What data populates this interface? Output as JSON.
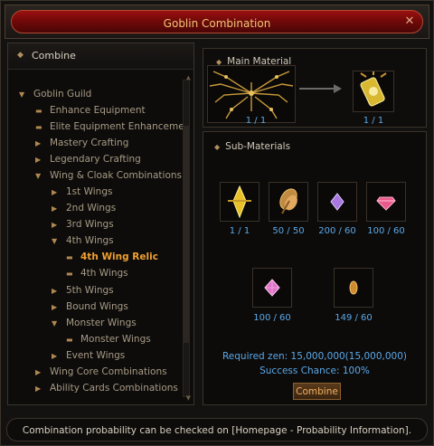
{
  "window": {
    "title": "Goblin Combination",
    "close_icon": "close-icon"
  },
  "left": {
    "header": "Combine",
    "tree": [
      {
        "label": "Goblin Guild",
        "icon": "caret-down-icon"
      },
      {
        "label": "Enhance Equipment",
        "icon": "dash-icon"
      },
      {
        "label": "Elite Equipment Enhancemen",
        "icon": "dash-icon"
      },
      {
        "label": "Mastery Crafting",
        "icon": "caret-right-icon"
      },
      {
        "label": "Legendary Crafting",
        "icon": "caret-right-icon"
      },
      {
        "label": "Wing & Cloak Combinations",
        "icon": "caret-down-icon"
      },
      {
        "label": "1st Wings",
        "icon": "caret-right-icon"
      },
      {
        "label": "2nd Wings",
        "icon": "caret-right-icon"
      },
      {
        "label": "3rd Wings",
        "icon": "caret-right-icon"
      },
      {
        "label": "4th Wings",
        "icon": "caret-down-icon"
      },
      {
        "label": "4th Wing Relic",
        "icon": "dash-icon",
        "active": true
      },
      {
        "label": "4th Wings",
        "icon": "dash-icon"
      },
      {
        "label": "5th Wings",
        "icon": "caret-right-icon"
      },
      {
        "label": "Bound Wings",
        "icon": "caret-right-icon"
      },
      {
        "label": "Monster Wings",
        "icon": "caret-down-icon"
      },
      {
        "label": "Monster Wings",
        "icon": "dash-icon"
      },
      {
        "label": "Event Wings",
        "icon": "caret-right-icon"
      },
      {
        "label": "Wing Core Combinations",
        "icon": "caret-right-icon"
      },
      {
        "label": "Ability Cards Combinations",
        "icon": "caret-right-icon"
      }
    ]
  },
  "main": {
    "label": "Main Material",
    "items": [
      {
        "icon": "golden-wings-icon",
        "count": "1 / 1"
      },
      {
        "icon": "wing-relic-icon",
        "count": "1 / 1"
      }
    ]
  },
  "sub": {
    "label": "Sub-Materials",
    "items": [
      {
        "icon": "golden-crystal-icon",
        "count": "1 / 1"
      },
      {
        "icon": "feather-icon",
        "count": "50 / 50"
      },
      {
        "icon": "purple-gem-icon",
        "count": "200 / 60"
      },
      {
        "icon": "pink-gem-icon",
        "count": "100 / 60"
      },
      {
        "icon": "pink-crystal-icon",
        "count": "100 / 60"
      },
      {
        "icon": "amber-seed-icon",
        "count": "149 / 60"
      }
    ],
    "zen": "Required zen: 15,000,000(15,000,000)",
    "chance": "Success Chance: 100%",
    "combine": "Combine"
  },
  "footer": "Combination probability can be checked on [Homepage - Probability Information]."
}
